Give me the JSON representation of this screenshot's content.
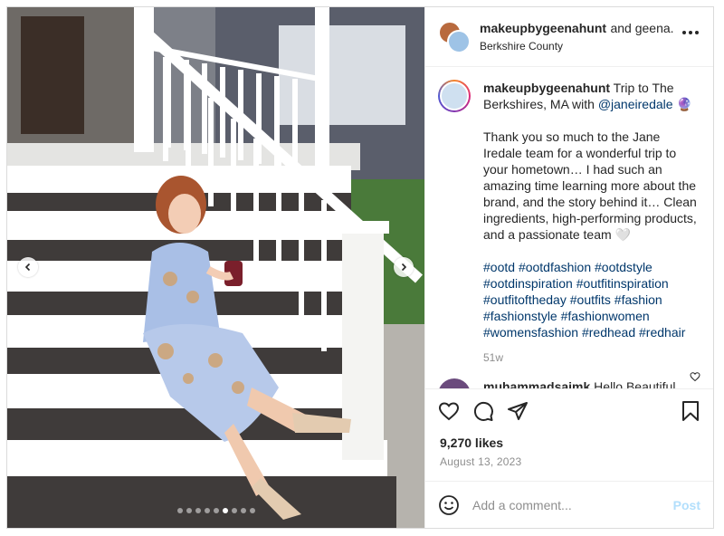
{
  "header": {
    "username": "makeupbygeenahunt",
    "coauthor_text": "and geena.",
    "location": "Berkshire County"
  },
  "caption": {
    "username": "makeupbygeenahunt",
    "title_text": "Trip to The Berkshires, MA with",
    "mention": "@janeiredale",
    "emoji": "🔮",
    "body": "Thank you so much to the Jane Iredale team for a wonderful trip to your hometown… I had such an amazing time learning more about the brand, and the story behind it… Clean ingredients, high-performing products, and a passionate team 🤍",
    "hashtags": [
      "#ootd",
      "#ootdfashion",
      "#ootdstyle",
      "#ootdinspiration",
      "#outfitinspiration",
      "#outfitoftheday",
      "#outfits",
      "#fashion",
      "#fashionstyle",
      "#fashionwomen",
      "#womensfashion",
      "#redhead",
      "#redhair"
    ],
    "age": "51w"
  },
  "comment": {
    "username": "muhammadsaimk",
    "text": "Hello Beautiful"
  },
  "likes": "9,270 likes",
  "date": "August 13, 2023",
  "add_comment": {
    "placeholder": "Add a comment...",
    "post_label": "Post"
  },
  "carousel": {
    "total": 9,
    "current": 6
  },
  "icons": {
    "like": "heart-icon",
    "comment": "comment-icon",
    "share": "share-icon",
    "save": "bookmark-icon",
    "emoji": "emoji-icon",
    "more": "more-options-icon",
    "prev": "chevron-left-icon",
    "next": "chevron-right-icon"
  },
  "colors": {
    "link": "#00376b",
    "muted": "#8e8e8e",
    "post_disabled": "#b2dffc"
  }
}
